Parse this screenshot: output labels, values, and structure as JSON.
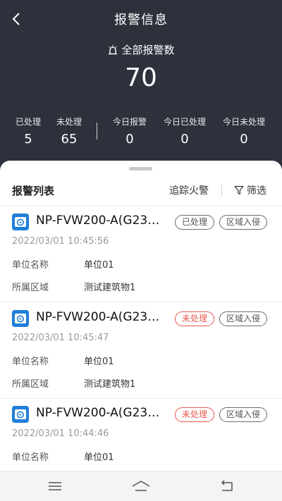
{
  "header": {
    "title": "报警信息"
  },
  "summary": {
    "total_label": "全部报警数",
    "total_value": "70"
  },
  "stats": [
    {
      "label": "已处理",
      "value": "5"
    },
    {
      "label": "未处理",
      "value": "65"
    },
    {
      "label": "今日报警",
      "value": "0"
    },
    {
      "label": "今日已处理",
      "value": "0"
    },
    {
      "label": "今日未处理",
      "value": "0"
    }
  ],
  "list": {
    "title": "报警列表",
    "track_fire_label": "追踪火警",
    "filter_label": "筛选"
  },
  "alarms": [
    {
      "device": "NP-FVW200-A(G23…",
      "status": "已处理",
      "type": "区域入侵",
      "time": "2022/03/01 10:45:56",
      "unit_label": "单位名称",
      "unit_value": "单位01",
      "area_label": "所属区域",
      "area_value": "测试建筑物1"
    },
    {
      "device": "NP-FVW200-A(G23…",
      "status": "未处理",
      "type": "区域入侵",
      "time": "2022/03/01 10:45:47",
      "unit_label": "单位名称",
      "unit_value": "单位01",
      "area_label": "所属区域",
      "area_value": "测试建筑物1"
    },
    {
      "device": "NP-FVW200-A(G23…",
      "status": "未处理",
      "type": "区域入侵",
      "time": "2022/03/01 10:44:46",
      "unit_label": "单位名称",
      "unit_value": "单位01"
    }
  ],
  "colors": {
    "header_bg": "#2d313c",
    "accent": "#1f7fd8",
    "unprocessed": "#e65a4f"
  }
}
